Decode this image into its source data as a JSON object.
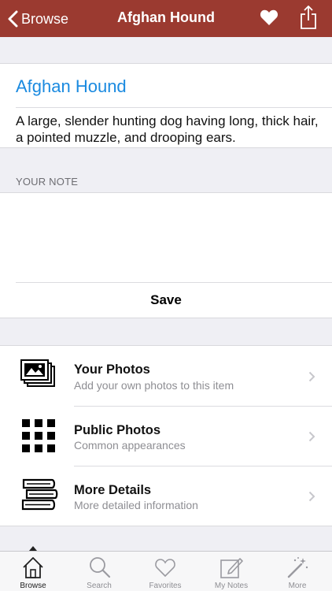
{
  "colors": {
    "nav_background": "#9b3a30",
    "accent_blue": "#1a8ae0",
    "page_background": "#efeff4"
  },
  "navbar": {
    "back_label": "Browse",
    "title": "Afghan Hound",
    "favorite_icon": "heart-icon",
    "share_icon": "share-icon"
  },
  "entry": {
    "word": "Afghan Hound",
    "definition": "A large, slender hunting dog having long, thick hair, a pointed muzzle, and drooping ears."
  },
  "note": {
    "header": "YOUR NOTE",
    "value": "",
    "save_label": "Save"
  },
  "rows": [
    {
      "title": "Your Photos",
      "subtitle": "Add your own photos to this item",
      "icon": "photos-icon"
    },
    {
      "title": "Public Photos",
      "subtitle": "Common appearances",
      "icon": "grid-icon"
    },
    {
      "title": "More Details",
      "subtitle": "More detailed information",
      "icon": "books-icon"
    }
  ],
  "tabbar": {
    "active": "Browse",
    "tabs": [
      {
        "label": "Browse",
        "icon": "home-icon"
      },
      {
        "label": "Search",
        "icon": "magnifier-icon"
      },
      {
        "label": "Favorites",
        "icon": "heart-outline-icon"
      },
      {
        "label": "My Notes",
        "icon": "note-edit-icon"
      },
      {
        "label": "More",
        "icon": "magic-wand-icon"
      }
    ]
  }
}
